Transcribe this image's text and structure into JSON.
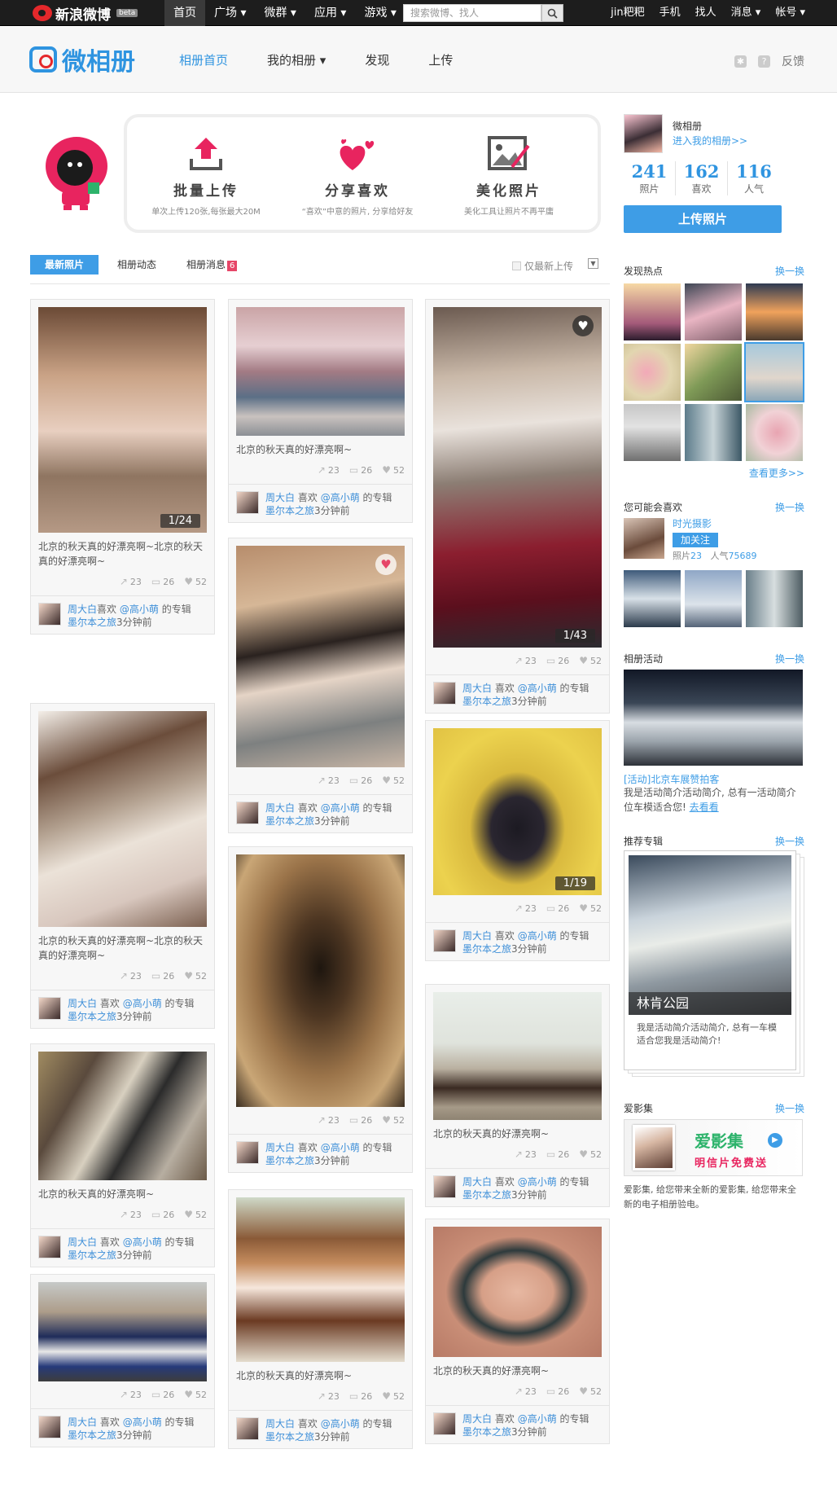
{
  "topbar": {
    "logo": "新浪微博",
    "beta": "beta",
    "nav": [
      "首页",
      "广场",
      "微群",
      "应用",
      "游戏"
    ],
    "search_placeholder": "搜索微博、找人",
    "right": [
      "jin粑粑",
      "手机",
      "找人",
      "消息",
      "帐号"
    ]
  },
  "header": {
    "brand": "微相册",
    "nav": [
      "相册首页",
      "我的相册",
      "发现",
      "上传"
    ],
    "feedback": "反馈"
  },
  "promo": [
    {
      "title": "批量上传",
      "sub": "单次上传120张,每张最大20M"
    },
    {
      "title": "分享喜欢",
      "sub": "“喜欢”中意的照片, 分享给好友"
    },
    {
      "title": "美化照片",
      "sub": "美化工具让照片不再平庸"
    }
  ],
  "tabs": {
    "items": [
      "最新照片",
      "相册动态",
      "相册消息"
    ],
    "badge": "6",
    "only_new": "仅最新上传"
  },
  "card_common": {
    "shares": "23",
    "comments": "26",
    "likes": "52",
    "user": "周大白",
    "action": "喜欢",
    "mention": "@高小萌",
    "suffix": "的专辑",
    "album": "墨尔本之旅",
    "time": "3分钟前"
  },
  "cards": [
    {
      "caption": "北京的秋天真的好漂亮啊~北京的秋天真的好漂亮啊~",
      "counter": "1/24"
    },
    {
      "caption": "北京的秋天真的好漂亮啊~北京的秋天真的好漂亮啊~",
      "counter": ""
    },
    {
      "caption": "北京的秋天真的好漂亮啊~",
      "counter": ""
    },
    {
      "caption": "",
      "counter": ""
    },
    {
      "caption": "北京的秋天真的好漂亮啊~",
      "counter": ""
    },
    {
      "caption": "",
      "counter": ""
    },
    {
      "caption": "",
      "counter": ""
    },
    {
      "caption": "北京的秋天真的好漂亮啊~",
      "counter": ""
    },
    {
      "caption": "",
      "counter": "1/43"
    },
    {
      "caption": "",
      "counter": "1/19"
    },
    {
      "caption": "北京的秋天真的好漂亮啊~",
      "counter": ""
    },
    {
      "caption": "北京的秋天真的好漂亮啊~",
      "counter": ""
    }
  ],
  "sidebar": {
    "profile_name": "微相册",
    "profile_link": "进入我的相册>>",
    "stats": [
      {
        "num": "241",
        "label": "照片"
      },
      {
        "num": "162",
        "label": "喜欢"
      },
      {
        "num": "116",
        "label": "人气"
      }
    ],
    "upload": "上传照片",
    "hot_title": "发现热点",
    "swap": "换一换",
    "see_more": "查看更多>>",
    "maylike_title": "您可能会喜欢",
    "maylike_name": "时光摄影",
    "follow": "加关注",
    "maylike_photos": "照片",
    "maylike_photos_num": "23",
    "maylike_pop": "人气",
    "maylike_pop_num": "75689",
    "activity_title": "相册活动",
    "activity_link": "[活动]北京车展赞拍客",
    "activity_text": "我是活动简介活动简介, 总有一活动简介位车模适合您!",
    "activity_go": "去看看",
    "rec_title": "推荐专辑",
    "rec_album": "林肯公园",
    "rec_text": "我是活动简介活动简介, 总有一车模适合您我是活动简介!",
    "ai_title": "爱影集",
    "ai_banner_brand": "爱影集",
    "ai_banner_sub": "明信片免费送",
    "ai_text": "爱影集, 给您带来全新的爱影集, 给您带来全新的电子相册验电。"
  }
}
